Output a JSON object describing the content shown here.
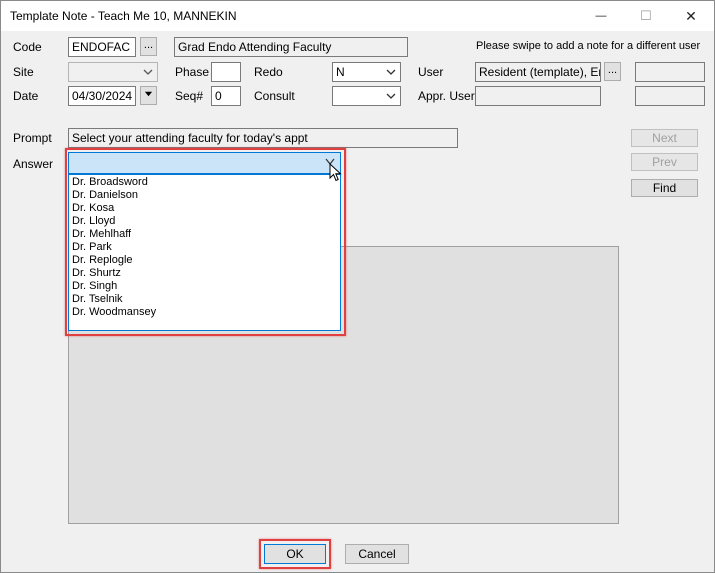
{
  "window": {
    "title": "Template Note - Teach Me 10, MANNEKIN",
    "minimize_glyph": "—",
    "maximize_glyph": "☐",
    "close_glyph": "✕"
  },
  "header": {
    "code_label": "Code",
    "code_value": "ENDOFAC",
    "code_browse": "...",
    "code_description": "Grad Endo Attending Faculty",
    "swipe_notice": "Please swipe to add a note for a different user",
    "site_label": "Site",
    "site_value": "",
    "phase_label": "Phase",
    "phase_value": "",
    "redo_label": "Redo",
    "redo_value": "N",
    "user_label": "User",
    "user_value": "Resident (template), Endo",
    "user_browse": "...",
    "date_label": "Date",
    "date_value": "04/30/2024",
    "seq_label": "Seq#",
    "seq_value": "0",
    "consult_label": "Consult",
    "consult_value": "",
    "appr_user_label": "Appr. User",
    "appr_user_value": ""
  },
  "prompt": {
    "prompt_label": "Prompt",
    "prompt_text": "Select your attending faculty for today's appt",
    "answer_label": "Answer",
    "answer_value": ""
  },
  "dropdown": {
    "options": [
      "Dr. Broadsword",
      "Dr. Danielson",
      "Dr. Kosa",
      "Dr. Lloyd",
      "Dr. Mehlhaff",
      "Dr. Park",
      "Dr. Replogle",
      "Dr. Shurtz",
      "Dr. Singh",
      "Dr. Tselnik",
      "Dr. Woodmansey"
    ]
  },
  "side_buttons": {
    "next": "Next",
    "prev": "Prev",
    "find": "Find"
  },
  "footer": {
    "ok": "OK",
    "cancel": "Cancel"
  },
  "colors": {
    "highlight": "#e04040",
    "combo_selected_border": "#0078d7"
  }
}
